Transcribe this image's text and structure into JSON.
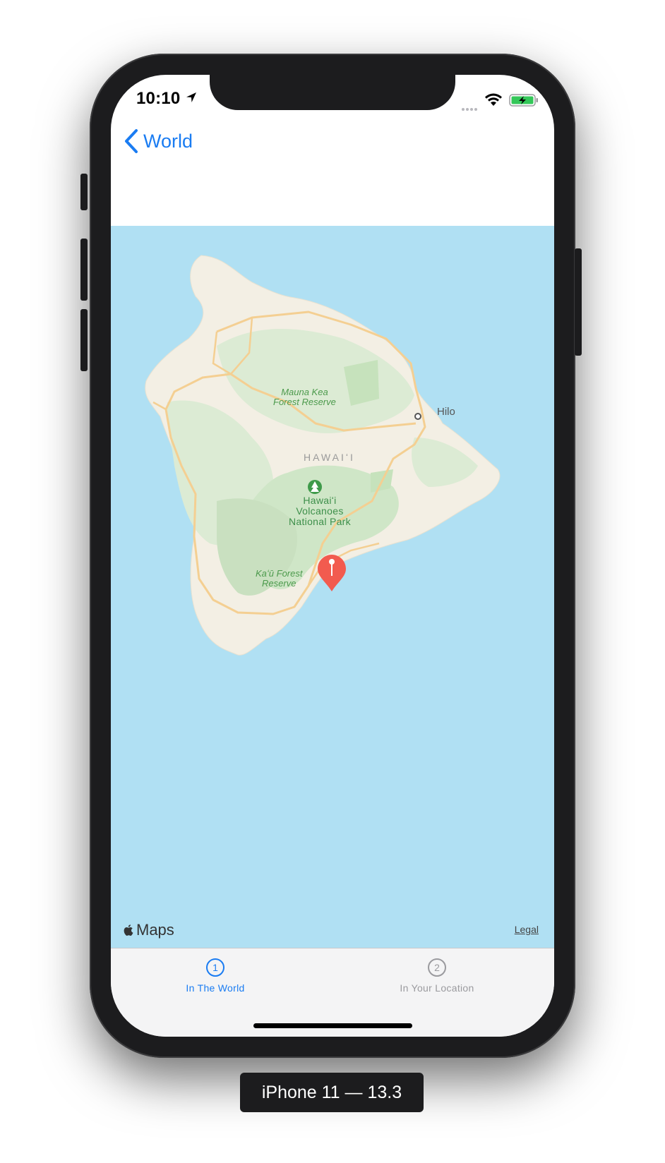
{
  "status_bar": {
    "time": "10:10",
    "location_icon": "location-arrow-icon",
    "signal_icon": "cellular-signal-icon",
    "wifi_icon": "wifi-icon",
    "battery_icon": "battery-charging-icon"
  },
  "nav": {
    "back_label": "World",
    "back_icon": "chevron-left-icon"
  },
  "map": {
    "labels": {
      "forest_reserve_1": "Mauna Kea\nForest Reserve",
      "city": "Hilo",
      "region": "HAWAIʻI",
      "park": "Hawaiʻi\nVolcanoes\nNational Park",
      "forest_reserve_2": "Kaʻū Forest\nReserve"
    },
    "logo_text": "Maps",
    "legal_label": "Legal",
    "pin_icon": "map-pin-icon"
  },
  "tabs": [
    {
      "number": "1",
      "label": "In The World",
      "active": true
    },
    {
      "number": "2",
      "label": "In Your Location",
      "active": false
    }
  ],
  "device_label": "iPhone 11 — 13.3",
  "colors": {
    "accent": "#1a7cf2",
    "water": "#b0e0f3",
    "land": "#f3efe4",
    "park": "#cfe6c7",
    "pin": "#f25b4f"
  }
}
